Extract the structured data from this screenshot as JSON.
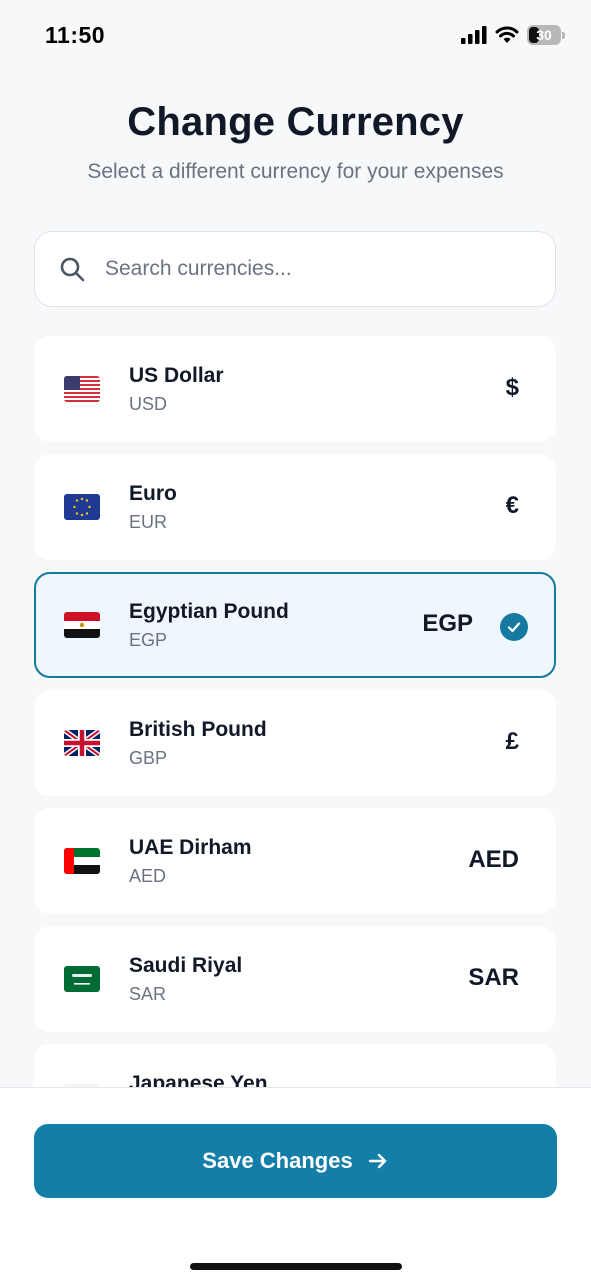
{
  "status": {
    "time": "11:50",
    "battery": "30"
  },
  "header": {
    "title": "Change Currency",
    "subtitle": "Select a different currency for your expenses"
  },
  "search": {
    "placeholder": "Search currencies...",
    "value": ""
  },
  "currencies": [
    {
      "name": "US Dollar",
      "code": "USD",
      "symbol": "$",
      "flag": "us-flag",
      "selected": false
    },
    {
      "name": "Euro",
      "code": "EUR",
      "symbol": "€",
      "flag": "eu-flag",
      "selected": false
    },
    {
      "name": "Egyptian Pound",
      "code": "EGP",
      "symbol": "EGP",
      "flag": "egypt-flag",
      "selected": true
    },
    {
      "name": "British Pound",
      "code": "GBP",
      "symbol": "£",
      "flag": "uk-flag",
      "selected": false
    },
    {
      "name": "UAE Dirham",
      "code": "AED",
      "symbol": "AED",
      "flag": "uae-flag",
      "selected": false
    },
    {
      "name": "Saudi Riyal",
      "code": "SAR",
      "symbol": "SAR",
      "flag": "saudi-flag",
      "selected": false
    },
    {
      "name": "Japanese Yen",
      "code": "",
      "symbol": "",
      "flag": "japan-flag",
      "selected": false
    }
  ],
  "footer": {
    "save_label": "Save Changes"
  },
  "colors": {
    "accent": "#137ea8",
    "selected_bg": "#eef7fd",
    "page_bg": "#f6f8fa"
  }
}
